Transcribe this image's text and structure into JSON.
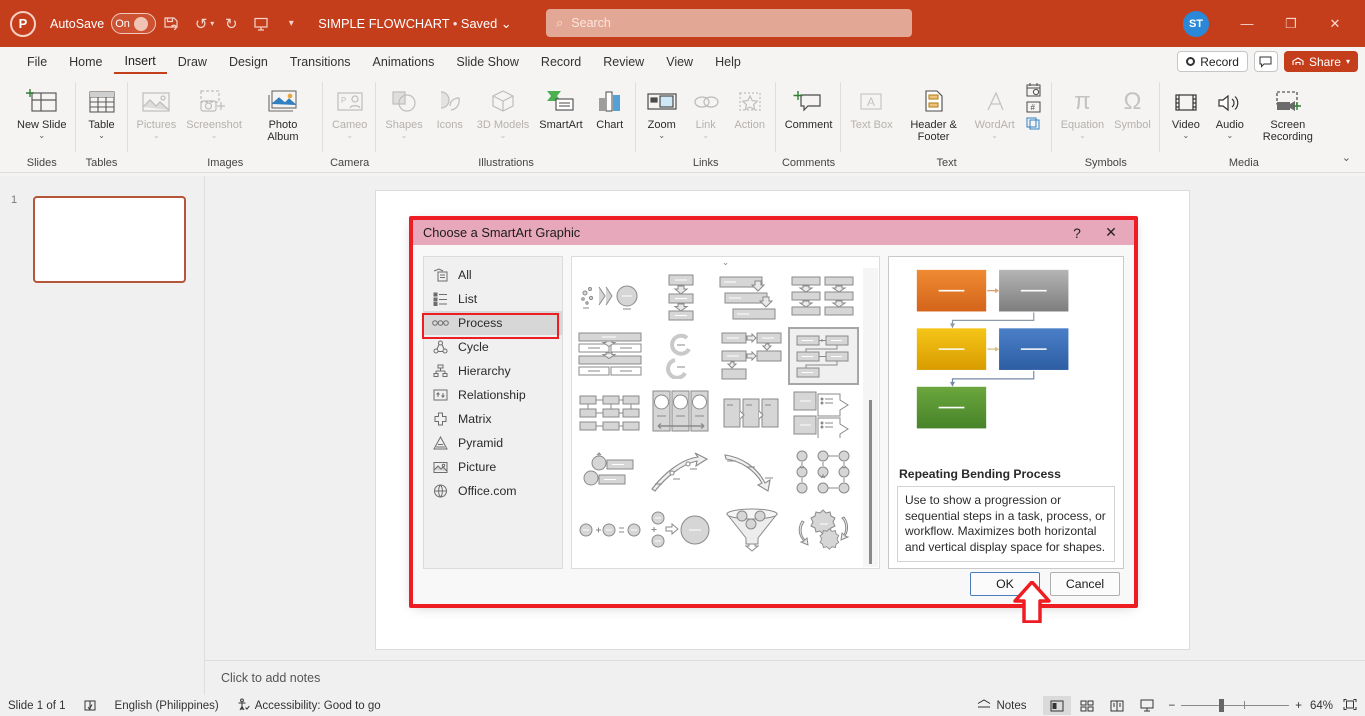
{
  "titlebar": {
    "logo": "P",
    "autosave_label": "AutoSave",
    "autosave_state": "On",
    "save_icon": "save-icon",
    "undo_icon": "undo-icon",
    "redo_icon": "redo-icon",
    "present_icon": "start-presentation-icon",
    "more_icon": "more-commands-icon",
    "doc_title": "SIMPLE FLOWCHART",
    "doc_status": "Saved",
    "avatar_initials": "ST",
    "minimize": "minimize-icon",
    "restore": "restore-icon",
    "close": "close-icon"
  },
  "search": {
    "placeholder": "Search",
    "icon": "search-icon"
  },
  "menubar": {
    "items": [
      {
        "label": "File",
        "active": false
      },
      {
        "label": "Home",
        "active": false
      },
      {
        "label": "Insert",
        "active": true
      },
      {
        "label": "Draw",
        "active": false
      },
      {
        "label": "Design",
        "active": false
      },
      {
        "label": "Transitions",
        "active": false
      },
      {
        "label": "Animations",
        "active": false
      },
      {
        "label": "Slide Show",
        "active": false
      },
      {
        "label": "Record",
        "active": false
      },
      {
        "label": "Review",
        "active": false
      },
      {
        "label": "View",
        "active": false
      },
      {
        "label": "Help",
        "active": false
      }
    ],
    "record_label": "Record",
    "comments_icon": "comment-icon",
    "share_label": "Share"
  },
  "ribbon": {
    "groups": [
      {
        "name": "Slides",
        "buttons": [
          {
            "label": "New Slide",
            "icon": "new-slide-icon",
            "caret": true,
            "disabled": false
          }
        ]
      },
      {
        "name": "Tables",
        "buttons": [
          {
            "label": "Table",
            "icon": "table-icon",
            "caret": true,
            "disabled": false
          }
        ]
      },
      {
        "name": "Images",
        "buttons": [
          {
            "label": "Pictures",
            "icon": "pictures-icon",
            "caret": true,
            "disabled": true
          },
          {
            "label": "Screenshot",
            "icon": "screenshot-icon",
            "caret": true,
            "disabled": true
          },
          {
            "label": "Photo Album",
            "icon": "photo-album-icon",
            "caret": true,
            "disabled": false
          }
        ]
      },
      {
        "name": "Camera",
        "buttons": [
          {
            "label": "Cameo",
            "icon": "cameo-icon",
            "caret": true,
            "disabled": true
          }
        ]
      },
      {
        "name": "Illustrations",
        "buttons": [
          {
            "label": "Shapes",
            "icon": "shapes-icon",
            "caret": true,
            "disabled": true
          },
          {
            "label": "Icons",
            "icon": "icons-icon",
            "caret": false,
            "disabled": true
          },
          {
            "label": "3D Models",
            "icon": "3d-models-icon",
            "caret": true,
            "disabled": true
          },
          {
            "label": "SmartArt",
            "icon": "smartart-icon",
            "caret": false,
            "disabled": false
          },
          {
            "label": "Chart",
            "icon": "chart-icon",
            "caret": false,
            "disabled": false
          }
        ]
      },
      {
        "name": "Links",
        "buttons": [
          {
            "label": "Zoom",
            "icon": "zoom-icon",
            "caret": true,
            "disabled": false
          },
          {
            "label": "Link",
            "icon": "link-icon",
            "caret": true,
            "disabled": true
          },
          {
            "label": "Action",
            "icon": "action-icon",
            "caret": false,
            "disabled": true
          }
        ]
      },
      {
        "name": "Comments",
        "buttons": [
          {
            "label": "Comment",
            "icon": "comment-add-icon",
            "caret": false,
            "disabled": false
          }
        ]
      },
      {
        "name": "Text",
        "buttons": [
          {
            "label": "Text Box",
            "icon": "text-box-icon",
            "caret": false,
            "disabled": true
          },
          {
            "label": "Header & Footer",
            "icon": "header-footer-icon",
            "caret": false,
            "disabled": false
          },
          {
            "label": "WordArt",
            "icon": "wordart-icon",
            "caret": true,
            "disabled": true
          },
          {
            "label": "",
            "icon": "date-time-slide-number-object-icons",
            "caret": false,
            "disabled": false
          }
        ]
      },
      {
        "name": "Symbols",
        "buttons": [
          {
            "label": "Equation",
            "icon": "equation-icon",
            "caret": true,
            "disabled": true
          },
          {
            "label": "Symbol",
            "icon": "symbol-icon",
            "caret": false,
            "disabled": true
          }
        ]
      },
      {
        "name": "Media",
        "buttons": [
          {
            "label": "Video",
            "icon": "video-icon",
            "caret": true,
            "disabled": false
          },
          {
            "label": "Audio",
            "icon": "audio-icon",
            "caret": true,
            "disabled": false
          },
          {
            "label": "Screen Recording",
            "icon": "screen-recording-icon",
            "caret": false,
            "disabled": false
          }
        ]
      }
    ],
    "collapse_icon": "chevron-down-icon"
  },
  "slides_pane": {
    "slide_number": "1"
  },
  "notes": {
    "placeholder": "Click to add notes"
  },
  "statusbar": {
    "slide_count": "Slide 1 of 1",
    "spellcheck_icon": "spellcheck-icon",
    "language": "English (Philippines)",
    "accessibility_icon": "accessibility-icon",
    "accessibility": "Accessibility: Good to go",
    "notes_label": "Notes",
    "views": [
      {
        "name": "normal-view",
        "icon": "normal-view-icon",
        "selected": true
      },
      {
        "name": "slide-sorter-view",
        "icon": "slide-sorter-icon",
        "selected": false
      },
      {
        "name": "reading-view",
        "icon": "reading-view-icon",
        "selected": false
      },
      {
        "name": "slide-show-view",
        "icon": "slide-show-icon",
        "selected": false
      }
    ],
    "zoom_out": "−",
    "zoom_in": "+",
    "zoom_level": "64%",
    "fit_icon": "fit-to-window-icon"
  },
  "dialog": {
    "title": "Choose a SmartArt Graphic",
    "help_btn": "?",
    "close_btn": "✕",
    "categories": [
      {
        "label": "All",
        "icon": "all-icon",
        "selected": false
      },
      {
        "label": "List",
        "icon": "list-icon",
        "selected": false
      },
      {
        "label": "Process",
        "icon": "process-icon",
        "selected": true
      },
      {
        "label": "Cycle",
        "icon": "cycle-icon",
        "selected": false
      },
      {
        "label": "Hierarchy",
        "icon": "hierarchy-icon",
        "selected": false
      },
      {
        "label": "Relationship",
        "icon": "relationship-icon",
        "selected": false
      },
      {
        "label": "Matrix",
        "icon": "matrix-icon",
        "selected": false
      },
      {
        "label": "Pyramid",
        "icon": "pyramid-icon",
        "selected": false
      },
      {
        "label": "Picture",
        "icon": "picture-icon",
        "selected": false
      },
      {
        "label": "Office.com",
        "icon": "globe-icon",
        "selected": false
      }
    ],
    "gallery": {
      "selected_index": 7,
      "thumbnails": [
        "random-to-result-process",
        "step-down-process",
        "step-up-process",
        "circle-accent-timeline",
        "basic-bending-process",
        "continuous-cycle-process",
        "alternating-flow",
        "repeating-bending-process",
        "vertical-bending-process",
        "process-list",
        "chevron-accent-process",
        "vertical-process-arrows",
        "accent-process",
        "ascending-bending-arrow",
        "descending-process",
        "circle-arrow-process",
        "equation",
        "converging-arrows",
        "funnel",
        "gear"
      ]
    },
    "preview": {
      "title": "Repeating Bending Process",
      "description": "Use to show a progression or sequential steps in a task, process, or workflow. Maximizes both horizontal and vertical display space for shapes.",
      "shape_colors": [
        "#e8761f",
        "#8e8e8e",
        "#e8b511",
        "#3b6bb5",
        "#569531"
      ]
    },
    "ok_label": "OK",
    "cancel_label": "Cancel"
  },
  "annotations": {
    "highlight_color": "#ee1d24",
    "arrow": "up-arrow-pointing-to-ok"
  }
}
